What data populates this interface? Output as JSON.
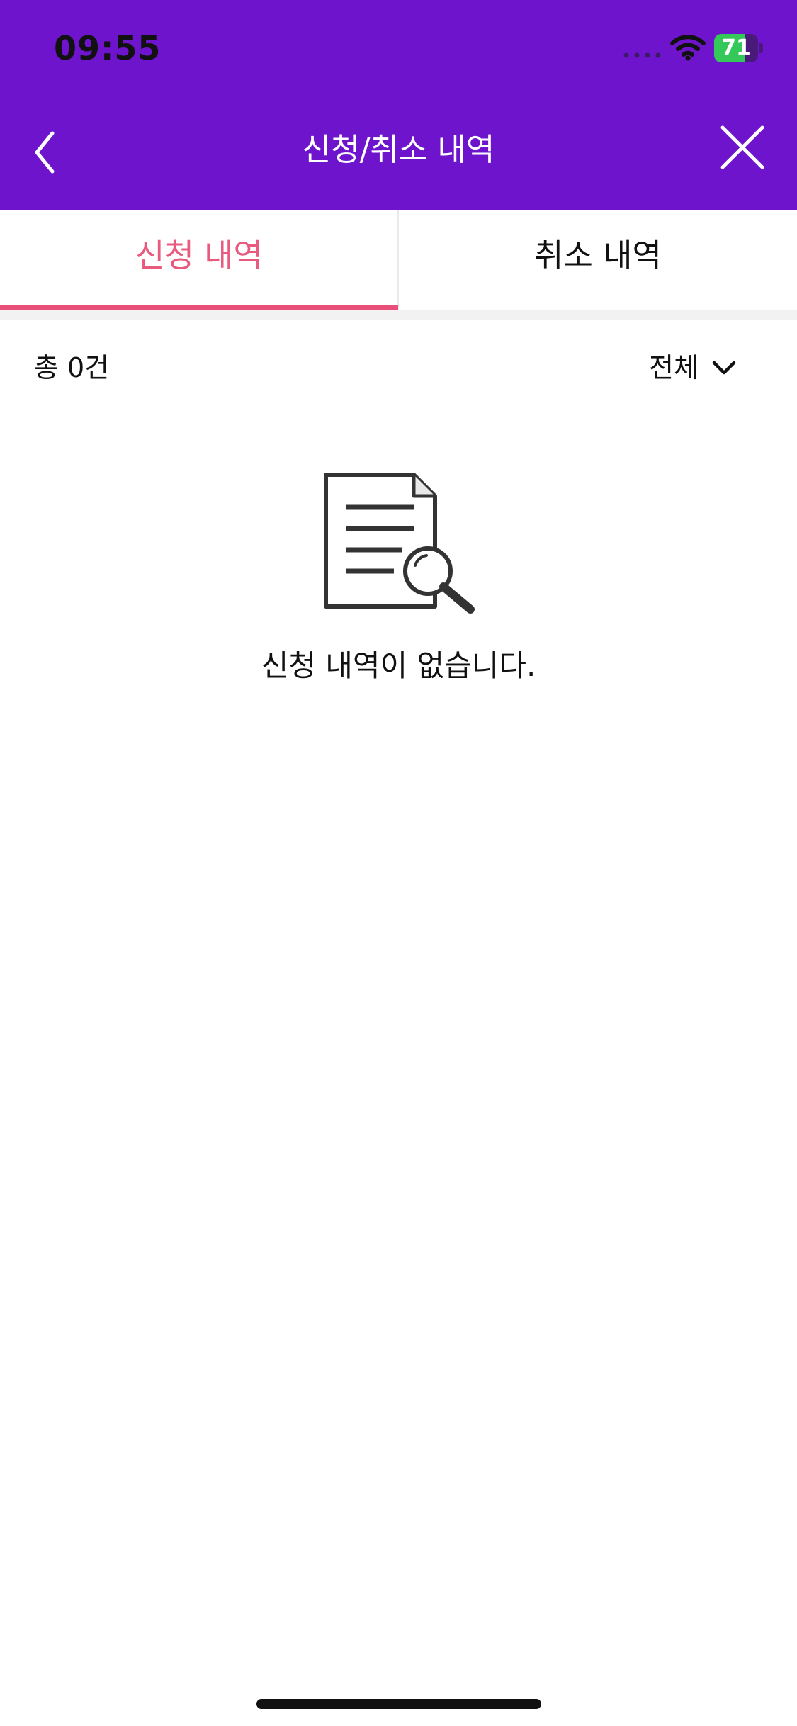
{
  "status_bar": {
    "time": "09:55",
    "battery_level": "71",
    "battery_percent": 71,
    "icons": [
      "signal-dots-icon",
      "wifi-icon",
      "battery-charging-icon"
    ]
  },
  "nav": {
    "title": "신청/취소 내역",
    "back_icon": "chevron-left-icon",
    "close_icon": "close-icon"
  },
  "tabs": [
    {
      "label": "신청 내역",
      "active": true
    },
    {
      "label": "취소 내역",
      "active": false
    }
  ],
  "summary": {
    "count_label": "총 0건",
    "filter_label": "전체",
    "filter_icon": "chevron-down-icon"
  },
  "empty_state": {
    "icon": "document-search-icon",
    "message": "신청 내역이 없습니다."
  },
  "colors": {
    "header": "#6e14cc",
    "tab_active": "#e85a7e",
    "tab_indicator": "#e8507a",
    "battery": "#34c759"
  }
}
